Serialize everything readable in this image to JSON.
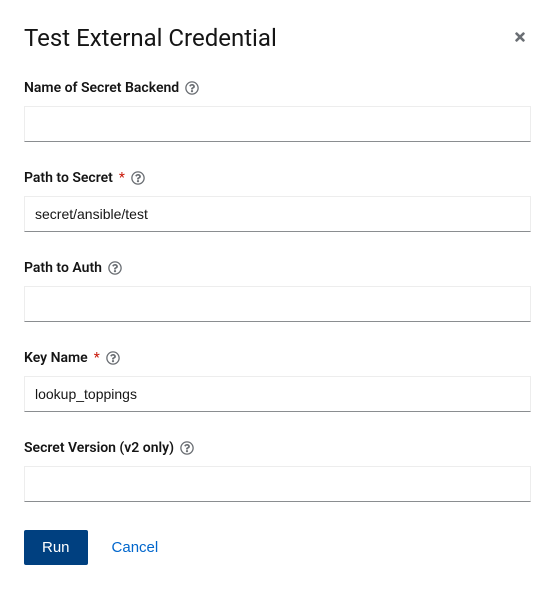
{
  "modal": {
    "title": "Test External Credential"
  },
  "fields": {
    "secret_backend": {
      "label": "Name of Secret Backend",
      "value": "",
      "required": false
    },
    "path_to_secret": {
      "label": "Path to Secret",
      "value": "secret/ansible/test",
      "required": true
    },
    "path_to_auth": {
      "label": "Path to Auth",
      "value": "",
      "required": false
    },
    "key_name": {
      "label": "Key Name",
      "value": "lookup_toppings",
      "required": true
    },
    "secret_version": {
      "label": "Secret Version (v2 only)",
      "value": "",
      "required": false
    }
  },
  "buttons": {
    "run": "Run",
    "cancel": "Cancel"
  },
  "symbols": {
    "required": "*"
  }
}
